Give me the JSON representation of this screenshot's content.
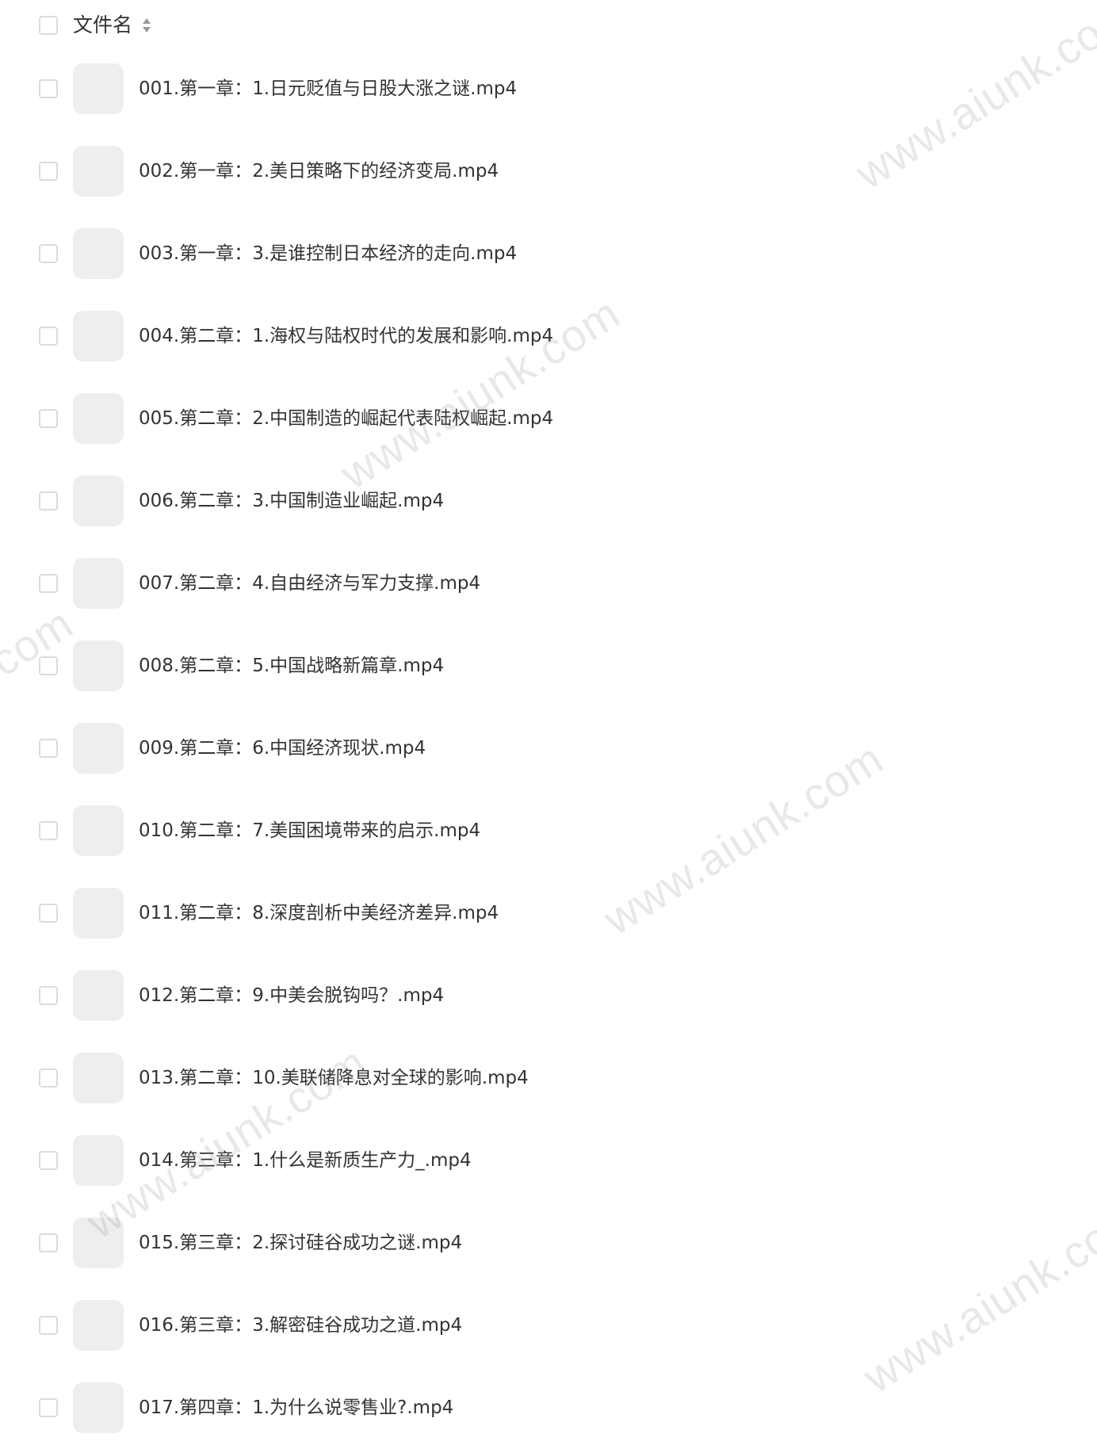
{
  "header": {
    "column_label": "文件名",
    "sort_icon": "sort-up-down-icon"
  },
  "files": [
    "001.第一章：1.日元贬值与日股大涨之谜.mp4",
    "002.第一章：2.美日策略下的经济变局.mp4",
    "003.第一章：3.是谁控制日本经济的走向.mp4",
    "004.第二章：1.海权与陆权时代的发展和影响.mp4",
    "005.第二章：2.中国制造的崛起代表陆权崛起.mp4",
    "006.第二章：3.中国制造业崛起.mp4",
    "007.第二章：4.自由经济与军力支撑.mp4",
    "008.第二章：5.中国战略新篇章.mp4",
    "009.第二章：6.中国经济现状.mp4",
    "010.第二章：7.美国困境带来的启示.mp4",
    "011.第二章：8.深度剖析中美经济差异.mp4",
    "012.第二章：9.中美会脱钩吗？.mp4",
    "013.第二章：10.美联储降息对全球的影响.mp4",
    "014.第三章：1.什么是新质生产力_.mp4",
    "015.第三章：2.探讨硅谷成功之谜.mp4",
    "016.第三章：3.解密硅谷成功之道.mp4",
    "017.第四章：1.为什么说零售业?.mp4"
  ],
  "watermarks": [
    "www.aiunk.co",
    "www.aiunk.com",
    "k.com",
    "www.aiunk.com",
    "www.aiunk.com",
    "www.aiunk.co"
  ]
}
